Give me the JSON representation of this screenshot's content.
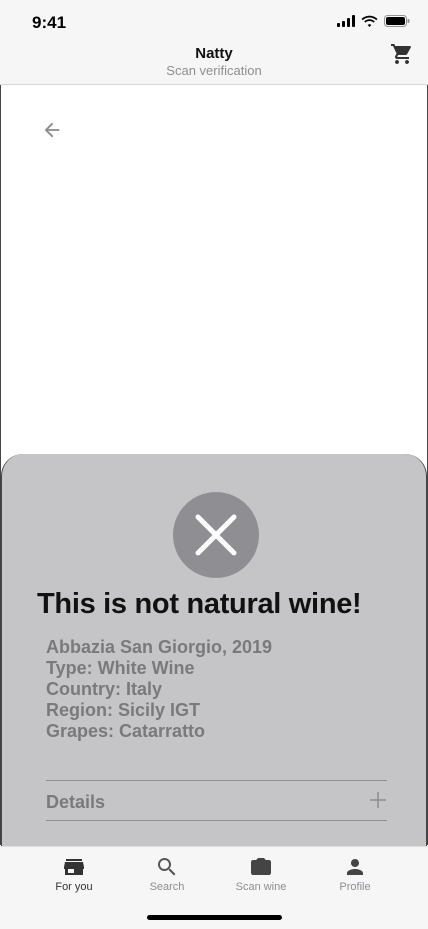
{
  "status_bar": {
    "time": "9:41"
  },
  "header": {
    "title": "Natty",
    "subtitle": "Scan verification"
  },
  "result": {
    "title": "This is not natural wine!",
    "lines": [
      "Abbazia San Giorgio, 2019",
      "Type: White Wine",
      "Country: Italy",
      "Region: Sicily IGT",
      "Grapes: Catarratto"
    ],
    "details_label": "Details"
  },
  "tabs": [
    {
      "label": "For you",
      "icon": "store-icon",
      "active": true
    },
    {
      "label": "Search",
      "icon": "search-icon",
      "active": false
    },
    {
      "label": "Scan wine",
      "icon": "camera-icon",
      "active": false
    },
    {
      "label": "Profile",
      "icon": "person-icon",
      "active": false
    }
  ],
  "colors": {
    "sheet": "#c5c5c8",
    "badge": "#8e8e93",
    "bars": "#f6f6f6"
  }
}
